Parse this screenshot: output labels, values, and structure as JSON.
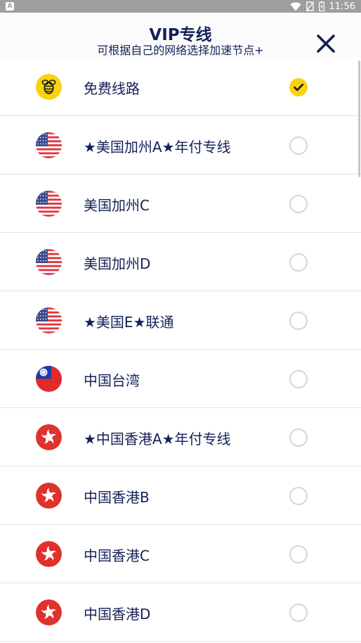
{
  "status_bar": {
    "app_letter": "A",
    "time": "11:56"
  },
  "header": {
    "title": "VIP专线",
    "subtitle": "可根据自己的网络选择加速节点+"
  },
  "colors": {
    "accent": "#f8d30f",
    "text": "#152158",
    "divider": "#e4e4e4"
  },
  "routes": [
    {
      "label": "免费线路",
      "icon": "bee-icon",
      "selected": true
    },
    {
      "label": "★美国加州A★年付专线",
      "icon": "us-flag-icon",
      "selected": false
    },
    {
      "label": "美国加州C",
      "icon": "us-flag-icon",
      "selected": false
    },
    {
      "label": "美国加州D",
      "icon": "us-flag-icon",
      "selected": false
    },
    {
      "label": "★美国E★联通",
      "icon": "us-flag-icon",
      "selected": false
    },
    {
      "label": "中国台湾",
      "icon": "taiwan-flag-icon",
      "selected": false
    },
    {
      "label": "★中国香港A★年付专线",
      "icon": "hk-flag-icon",
      "selected": false
    },
    {
      "label": "中国香港B",
      "icon": "hk-flag-icon",
      "selected": false
    },
    {
      "label": "中国香港C",
      "icon": "hk-flag-icon",
      "selected": false
    },
    {
      "label": "中国香港D",
      "icon": "hk-flag-icon",
      "selected": false
    }
  ]
}
